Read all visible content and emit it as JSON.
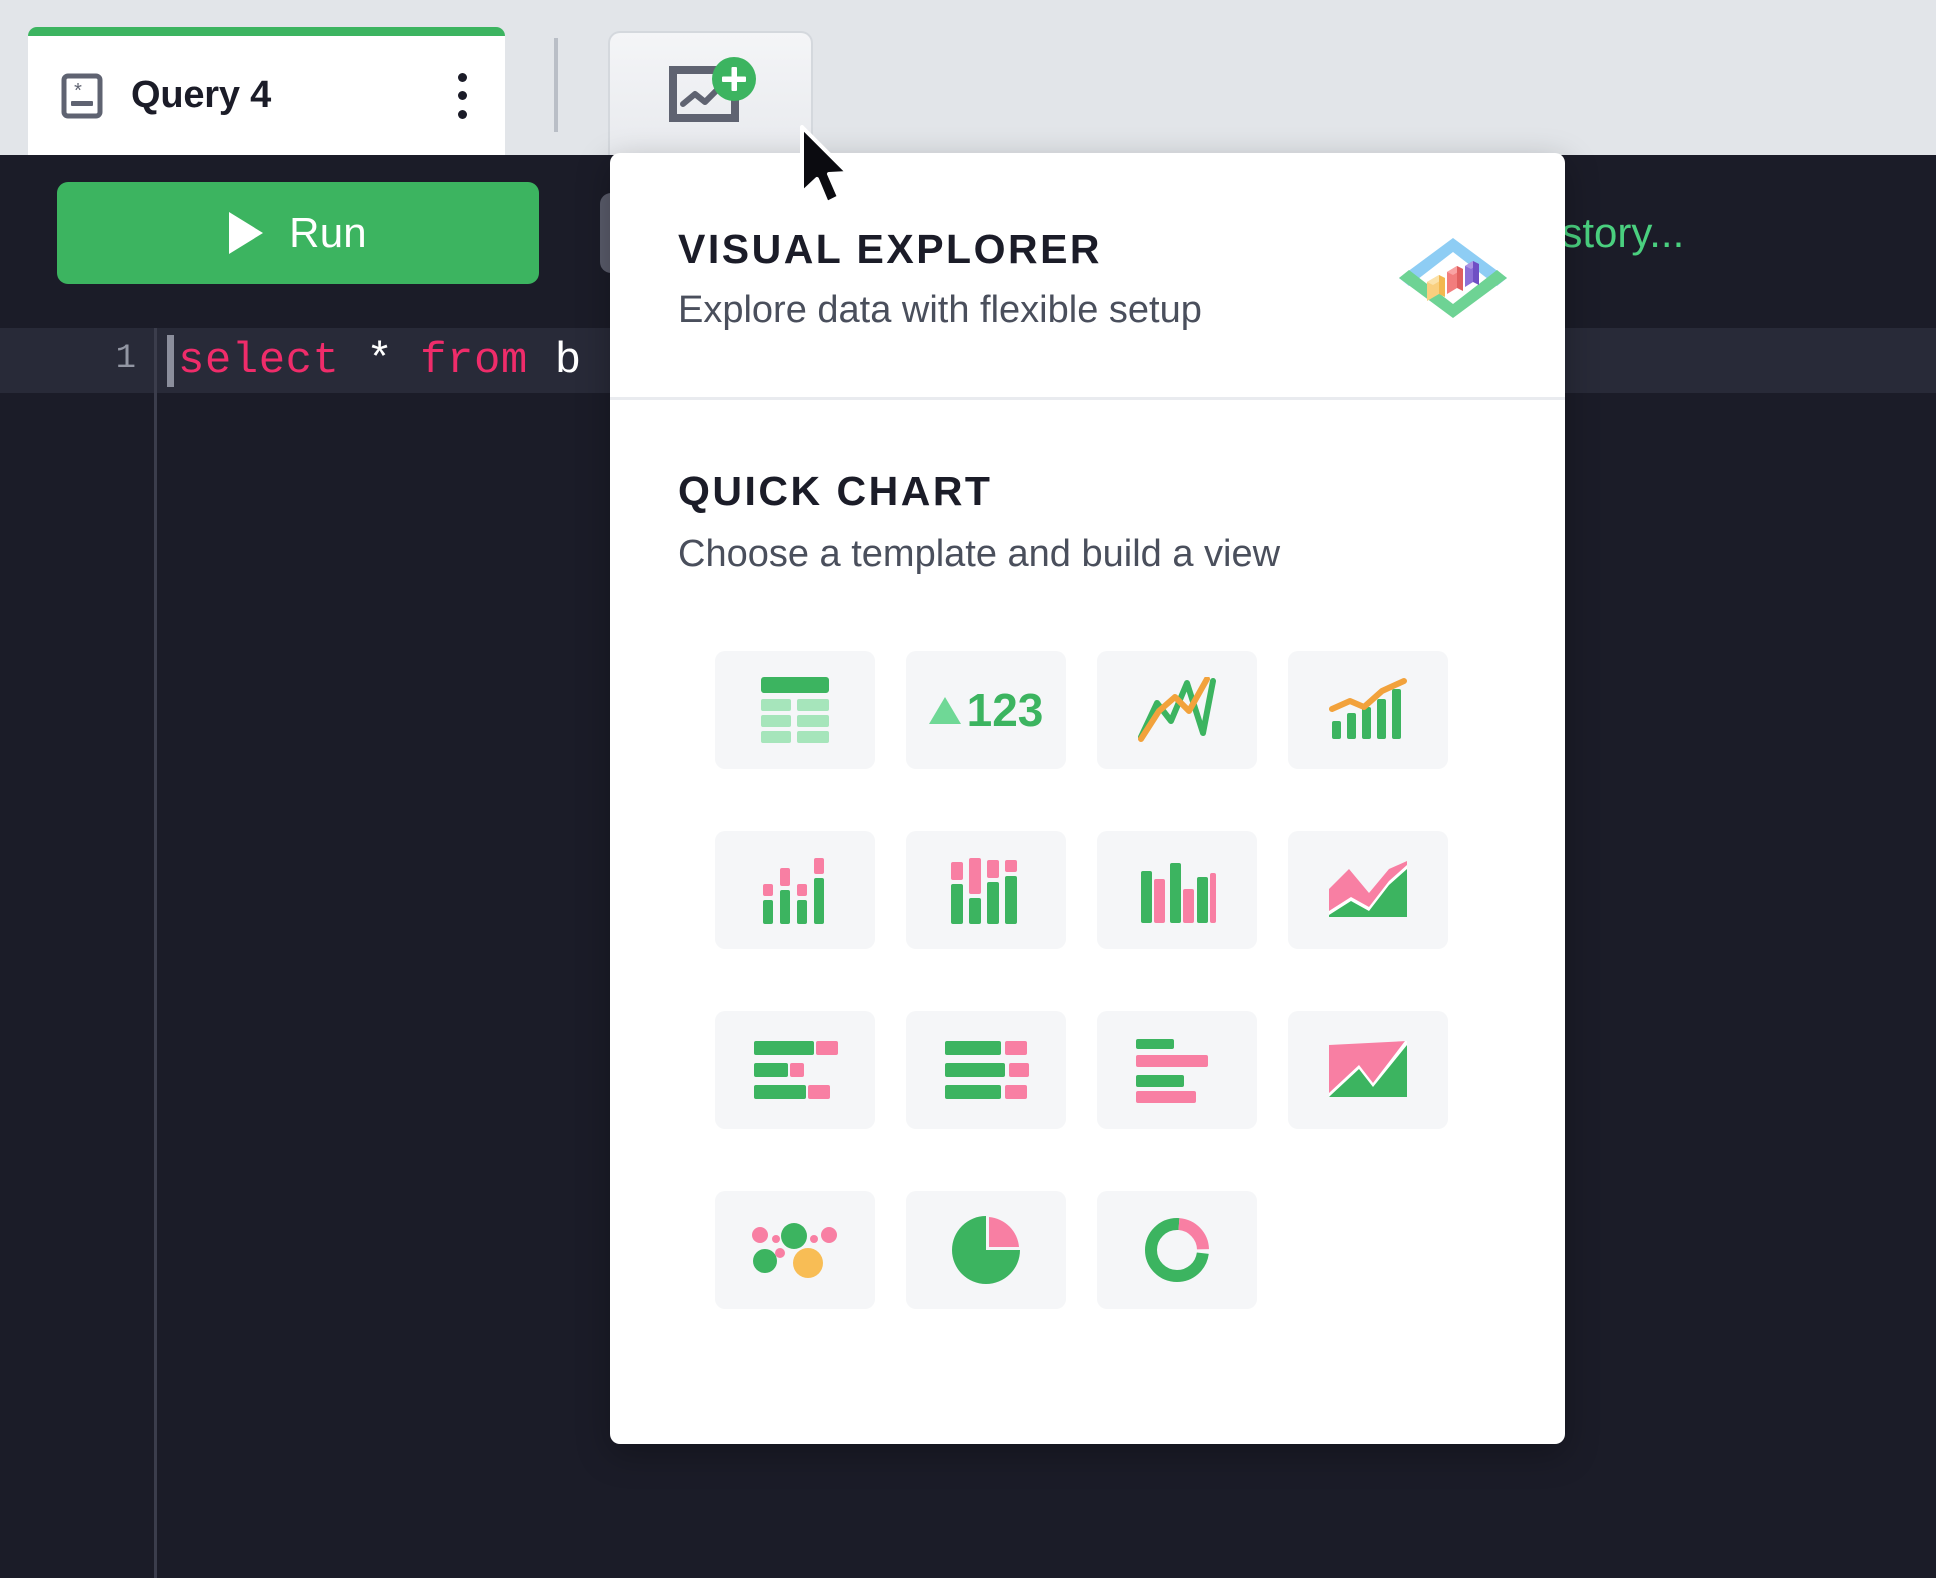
{
  "tabbar": {
    "active_tab": {
      "label": "Query 4",
      "icon": "query-script-icon",
      "menu_icon": "kebab-menu-icon"
    },
    "new_chart_tab": {
      "icon": "new-chart-icon",
      "badge_icon": "plus-badge-icon",
      "label": ""
    }
  },
  "toolbar": {
    "run_label": "Run",
    "run_icon": "play-icon",
    "history_label": "istory...",
    "accent_green": "#3cb460"
  },
  "editor": {
    "line_number": "1",
    "code": {
      "kw_select": "select",
      "op_star": "*",
      "kw_from": "from",
      "table": "b"
    }
  },
  "popup": {
    "visual_explorer": {
      "title": "VISUAL EXPLORER",
      "subtitle": "Explore data with flexible setup",
      "logo_icon": "visual-explorer-logo-icon"
    },
    "quick_chart": {
      "title": "QUICK CHART",
      "subtitle": "Choose a template and build a view",
      "templates": [
        {
          "id": "table",
          "icon": "table-chart-icon"
        },
        {
          "id": "kpi",
          "icon": "kpi-number-icon",
          "value": "123",
          "trend_icon": "triangle-up-icon"
        },
        {
          "id": "line",
          "icon": "line-chart-icon"
        },
        {
          "id": "bar-line-combo",
          "icon": "bar-line-combo-icon"
        },
        {
          "id": "stacked-bar-thin",
          "icon": "stacked-bar-chart-icon"
        },
        {
          "id": "stacked-bar-thick",
          "icon": "stacked-column-chart-icon"
        },
        {
          "id": "grouped-bar",
          "icon": "grouped-bar-chart-icon"
        },
        {
          "id": "stacked-area",
          "icon": "stacked-area-chart-icon"
        },
        {
          "id": "horizontal-stacked-bar",
          "icon": "horizontal-stacked-bar-icon"
        },
        {
          "id": "horizontal-grouped-bar",
          "icon": "horizontal-grouped-bar-icon"
        },
        {
          "id": "horizontal-bar",
          "icon": "horizontal-bar-chart-icon"
        },
        {
          "id": "area",
          "icon": "area-chart-icon"
        },
        {
          "id": "scatter-bubble",
          "icon": "bubble-chart-icon"
        },
        {
          "id": "pie",
          "icon": "pie-chart-icon"
        },
        {
          "id": "donut",
          "icon": "donut-chart-icon"
        }
      ]
    }
  },
  "colors": {
    "green": "#3cb460",
    "green_light": "#a6e5bb",
    "pink": "#f87fa3",
    "orange": "#f5b545",
    "keyword_pink": "#ef2c6a",
    "panel_bg": "#ffffff",
    "app_dark": "#1b1c28",
    "tabbar_bg": "#e2e5e9"
  },
  "cursor": {
    "icon": "mouse-pointer-icon"
  }
}
